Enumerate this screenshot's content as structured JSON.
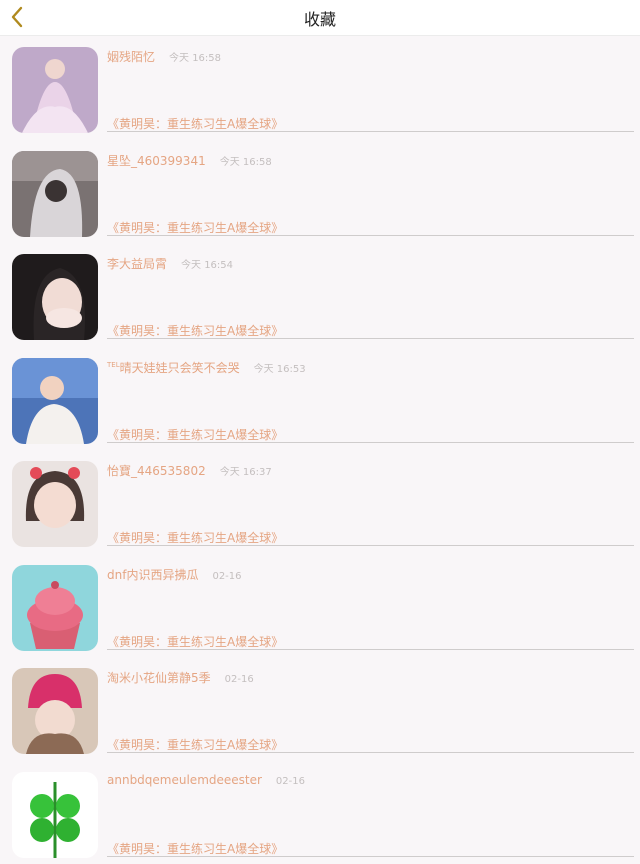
{
  "header": {
    "title": "收藏",
    "back_icon": "chevron-left-icon",
    "accent": "#b08a1e"
  },
  "colors": {
    "name": "#e5a583",
    "time": "#c4bfbf"
  },
  "items": [
    {
      "name": "姻残陌忆",
      "prefix": "",
      "time": "今天 16:58",
      "book": "《黄明昊：重生练习生A爆全球》",
      "avatar": "girl-in-pink-dress-avatar"
    },
    {
      "name": "星坠_460399341",
      "prefix": "",
      "time": "今天 16:58",
      "book": "《黄明昊：重生练习生A爆全球》",
      "avatar": "hooded-figure-avatar"
    },
    {
      "name": "李大益局霄",
      "prefix": "",
      "time": "今天 16:54",
      "book": "《黄明昊：重生练习生A爆全球》",
      "avatar": "girl-covering-mouth-avatar"
    },
    {
      "name": "晴天娃娃只会笑不会哭",
      "prefix": "TEL",
      "time": "今天 16:53",
      "book": "《黄明昊：重生练习生A爆全球》",
      "avatar": "boy-under-sky-avatar"
    },
    {
      "name": "怡寶_446535802",
      "prefix": "",
      "time": "今天 16:37",
      "book": "《黄明昊：重生练习生A爆全球》",
      "avatar": "little-girl-avatar"
    },
    {
      "name": "dnf内识西异拂瓜",
      "prefix": "",
      "time": "02-16",
      "book": "《黄明昊：重生练习生A爆全球》",
      "avatar": "cupcake-avatar"
    },
    {
      "name": "淘米小花仙第静5季",
      "prefix": "",
      "time": "02-16",
      "book": "《黄明昊：重生练习生A爆全球》",
      "avatar": "girl-pink-hat-avatar"
    },
    {
      "name": "annbdqemeulemdeeester",
      "prefix": "",
      "time": "02-16",
      "book": "《黄明昊：重生练习生A爆全球》",
      "avatar": "green-clover-avatar"
    }
  ]
}
